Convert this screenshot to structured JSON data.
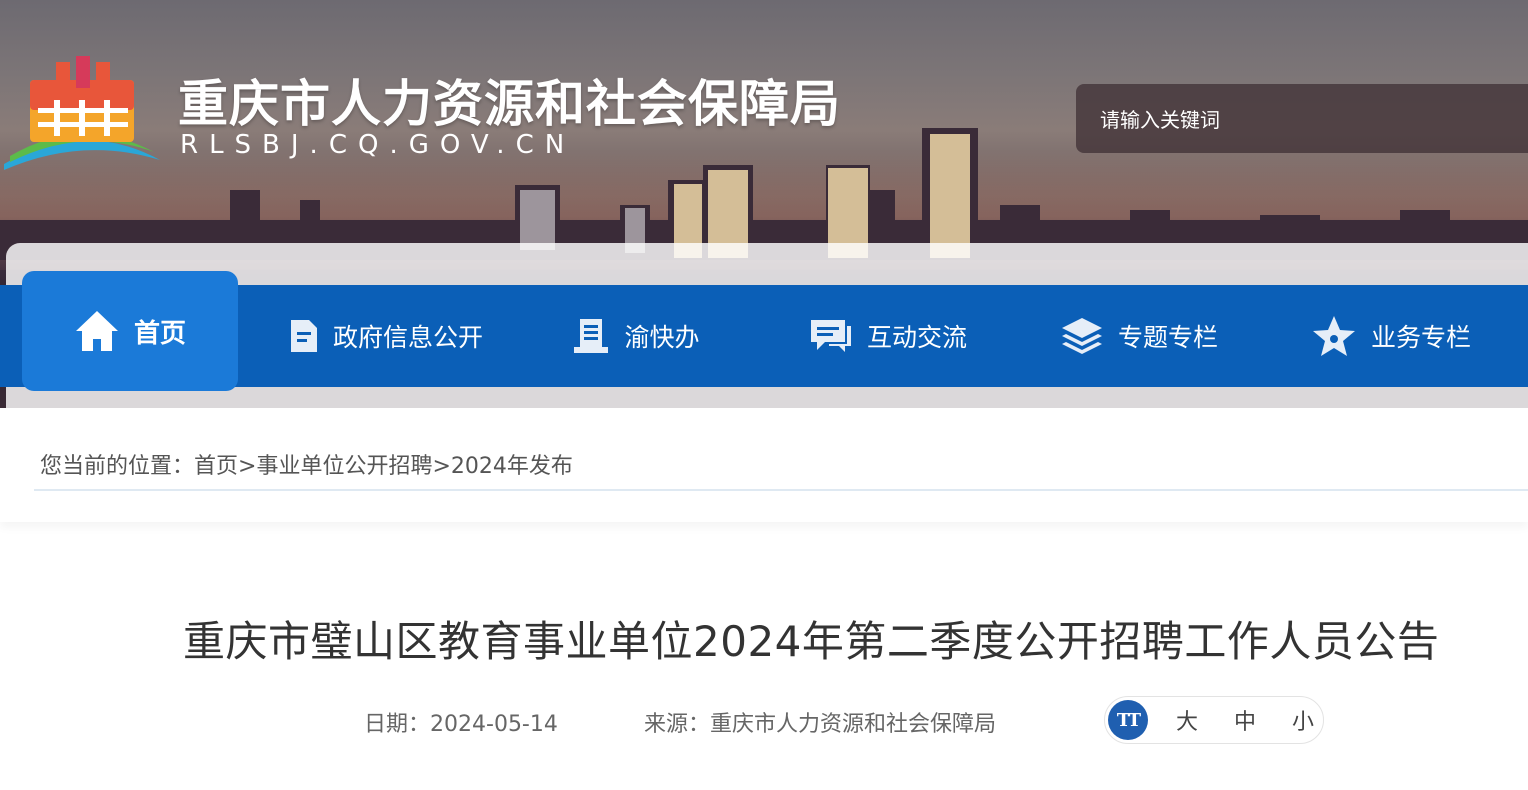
{
  "header": {
    "site_title": "重庆市人力资源和社会保障局",
    "site_domain": "RLSBJ.CQ.GOV.CN",
    "search_placeholder": "请输入关键词"
  },
  "nav": {
    "items": [
      {
        "label": "首页",
        "icon": "home-icon",
        "active": true
      },
      {
        "label": "政府信息公开",
        "icon": "document-icon"
      },
      {
        "label": "渝快办",
        "icon": "list-doc-icon"
      },
      {
        "label": "互动交流",
        "icon": "chat-icon"
      },
      {
        "label": "专题专栏",
        "icon": "layers-icon"
      },
      {
        "label": "业务专栏",
        "icon": "star-icon"
      }
    ]
  },
  "breadcrumb": {
    "prefix": "您当前的位置：",
    "items": [
      "首页",
      "事业单位公开招聘",
      "2024年发布"
    ],
    "separator": ">"
  },
  "article": {
    "title": "重庆市璧山区教育事业单位2024年第二季度公开招聘工作人员公告",
    "date_label": "日期：",
    "date": "2024-05-14",
    "source_label": "来源：",
    "source": "重庆市人力资源和社会保障局",
    "font_size": {
      "icon_text": "TT",
      "options": [
        "大",
        "中",
        "小"
      ]
    }
  },
  "colors": {
    "nav_bg": "#0b5fb7",
    "nav_active_bg": "#1b7ad8",
    "title_text": "#333333"
  }
}
